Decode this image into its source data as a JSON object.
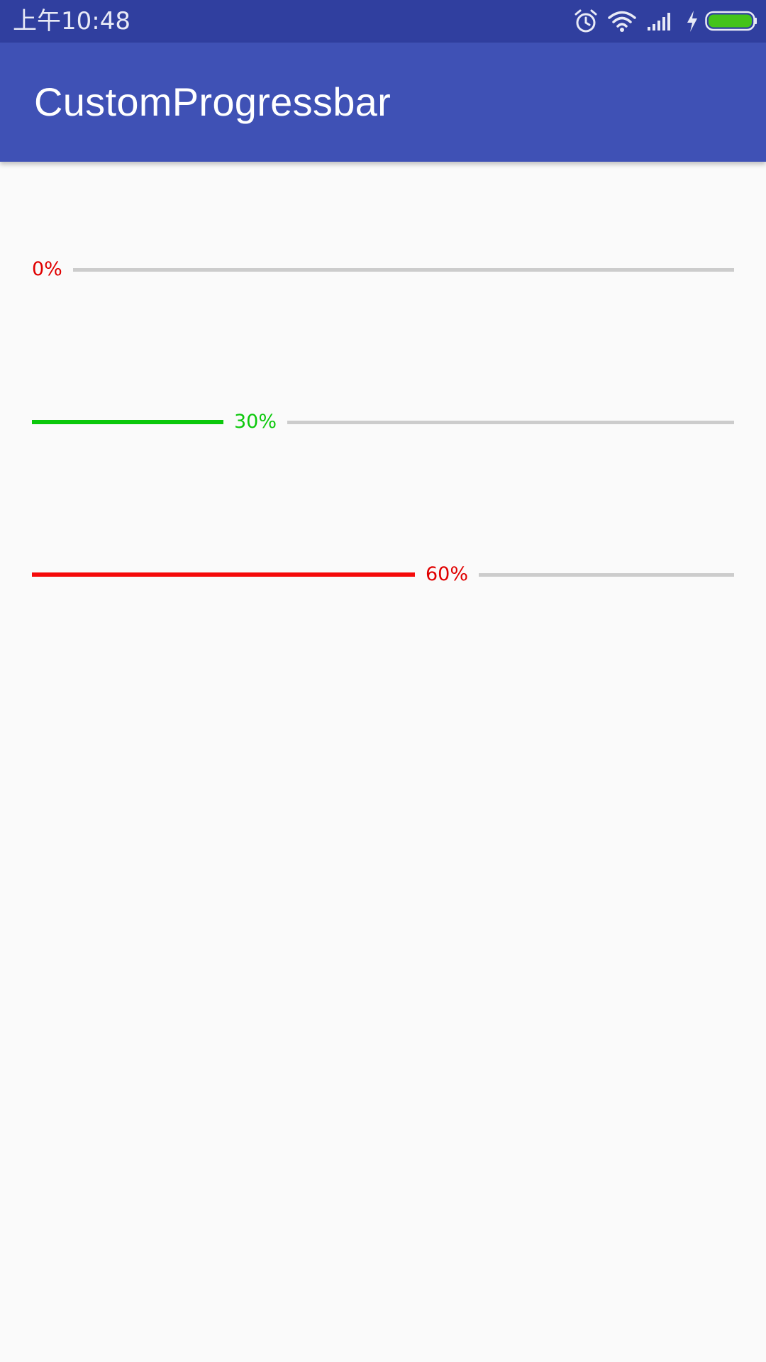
{
  "status_bar": {
    "time": "上午10:48",
    "icons": [
      "alarm-icon",
      "wifi-icon",
      "signal-icon",
      "charging-icon",
      "battery-icon"
    ],
    "battery_color": "#44c31a"
  },
  "app_bar": {
    "title": "CustomProgressbar",
    "color": "#3f51b5",
    "status_color": "#303f9f"
  },
  "progress_bars": [
    {
      "label": "0%",
      "progress": 0,
      "reached_color": "#f50a0a",
      "text_color": "#e00000",
      "unreached_color": "#cccccc"
    },
    {
      "label": "30%",
      "progress": 30,
      "reached_color": "#0bc80b",
      "text_color": "#0bc80b",
      "unreached_color": "#cccccc"
    },
    {
      "label": "60%",
      "progress": 60,
      "reached_color": "#f50a0a",
      "text_color": "#e00000",
      "unreached_color": "#cccccc"
    }
  ]
}
